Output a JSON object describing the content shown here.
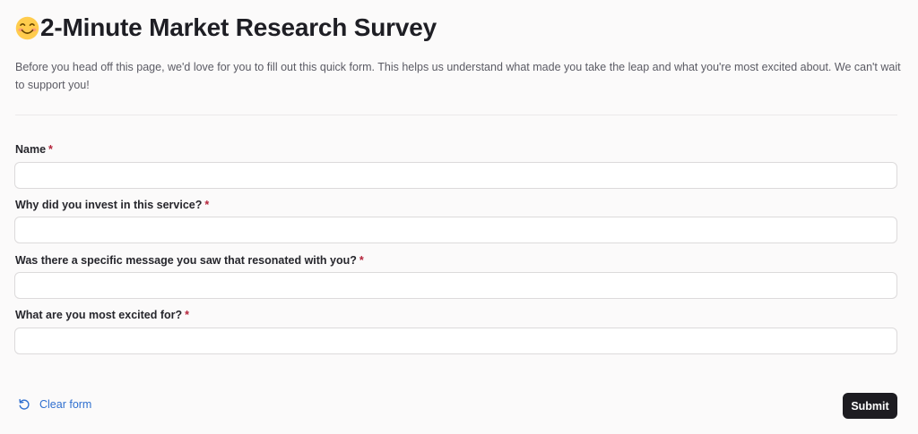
{
  "header": {
    "title": "2-Minute Market Research Survey",
    "icon": "smiling-face-emoji",
    "description": "Before you head off this page, we'd love for you to fill out this quick form. This helps us understand what made you take the leap and what you're most excited about. We can't wait to support you!"
  },
  "form": {
    "required_marker": "*",
    "fields": [
      {
        "label": "Name",
        "value": ""
      },
      {
        "label": "Why did you invest in this service?",
        "value": ""
      },
      {
        "label": "Was there a specific message you saw that resonated with you?",
        "value": ""
      },
      {
        "label": "What are you most excited for?",
        "value": ""
      }
    ]
  },
  "actions": {
    "clear_label": "Clear form",
    "clear_icon": "reset-icon",
    "submit_label": "Submit"
  },
  "colors": {
    "background": "#fbfafa",
    "accent_link": "#2f6fcf",
    "required": "#b4233a",
    "button": "#1d1c21"
  }
}
